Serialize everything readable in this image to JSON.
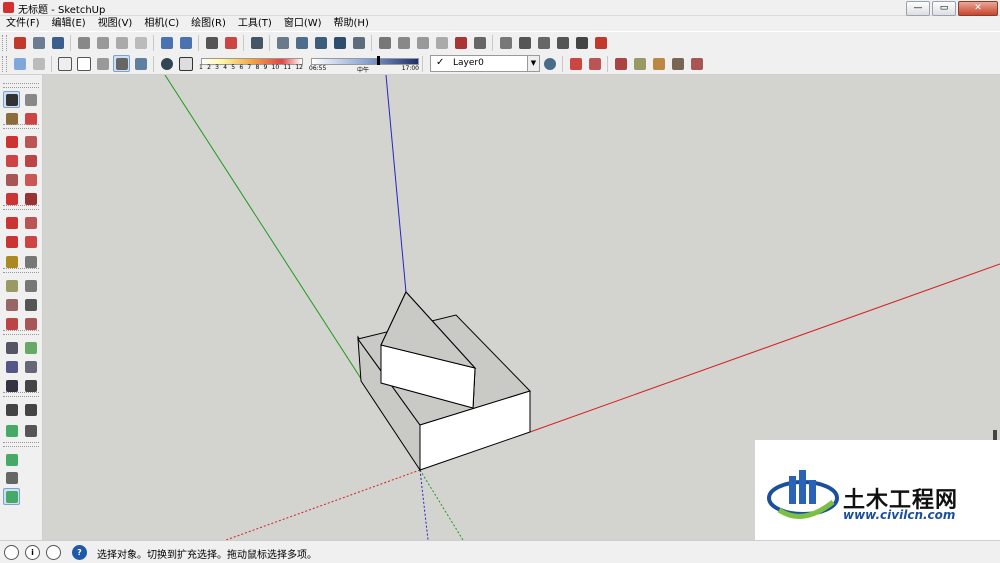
{
  "window": {
    "title": "无标题 - SketchUp",
    "minimize": "—",
    "maximize": "▭",
    "close": "✕"
  },
  "menu": [
    {
      "label": "文件(F)"
    },
    {
      "label": "编辑(E)"
    },
    {
      "label": "视图(V)"
    },
    {
      "label": "相机(C)"
    },
    {
      "label": "绘图(R)"
    },
    {
      "label": "工具(T)"
    },
    {
      "label": "窗口(W)"
    },
    {
      "label": "帮助(H)"
    }
  ],
  "toolbar1": {
    "groups": [
      [
        "new-icon",
        "open-icon",
        "save-icon"
      ],
      [
        "cut-icon",
        "copy-icon",
        "paste-icon",
        "erase-icon"
      ],
      [
        "undo-icon",
        "redo-icon"
      ],
      [
        "print-icon",
        "model-info-icon"
      ],
      [
        "camera-icon"
      ],
      [
        "iso-view-icon",
        "top-view-icon",
        "front-view-icon",
        "right-view-icon",
        "back-view-icon"
      ],
      [
        "section-icon",
        "texture-icon",
        "component-icon",
        "fill-icon",
        "paint-icon",
        "swap-icon"
      ],
      [
        "house-icon-1",
        "house-icon-2",
        "house-icon-3",
        "house-icon-4",
        "house-icon-5",
        "house-icon-6"
      ]
    ]
  },
  "toolbar2": {
    "shadow_ticks": [
      "1",
      "2",
      "3",
      "4",
      "5",
      "6",
      "7",
      "8",
      "9",
      "10",
      "11",
      "12"
    ],
    "time_start": "06:55",
    "time_mid": "中午",
    "time_end": "17:00",
    "time_value": 0.62,
    "layer_name": "Layer0",
    "layer_check": "✓",
    "layer_dropdown": "▼"
  },
  "status": {
    "text": "选择对象。切换到扩充选择。拖动鼠标选择多项。",
    "help_glyph": "?",
    "info_glyph": "i"
  },
  "watermark": {
    "text": "土木工程网",
    "url": "www.civilcn.com"
  },
  "colors": {
    "viewport_bg": "#d3d3cf",
    "face_front": "#ffffff",
    "face_side": "#c9c9c6",
    "axis_red": "#d62020",
    "axis_green": "#1f9a1f",
    "axis_blue": "#2424c8",
    "watermark_blue": "#1b4f9c"
  }
}
